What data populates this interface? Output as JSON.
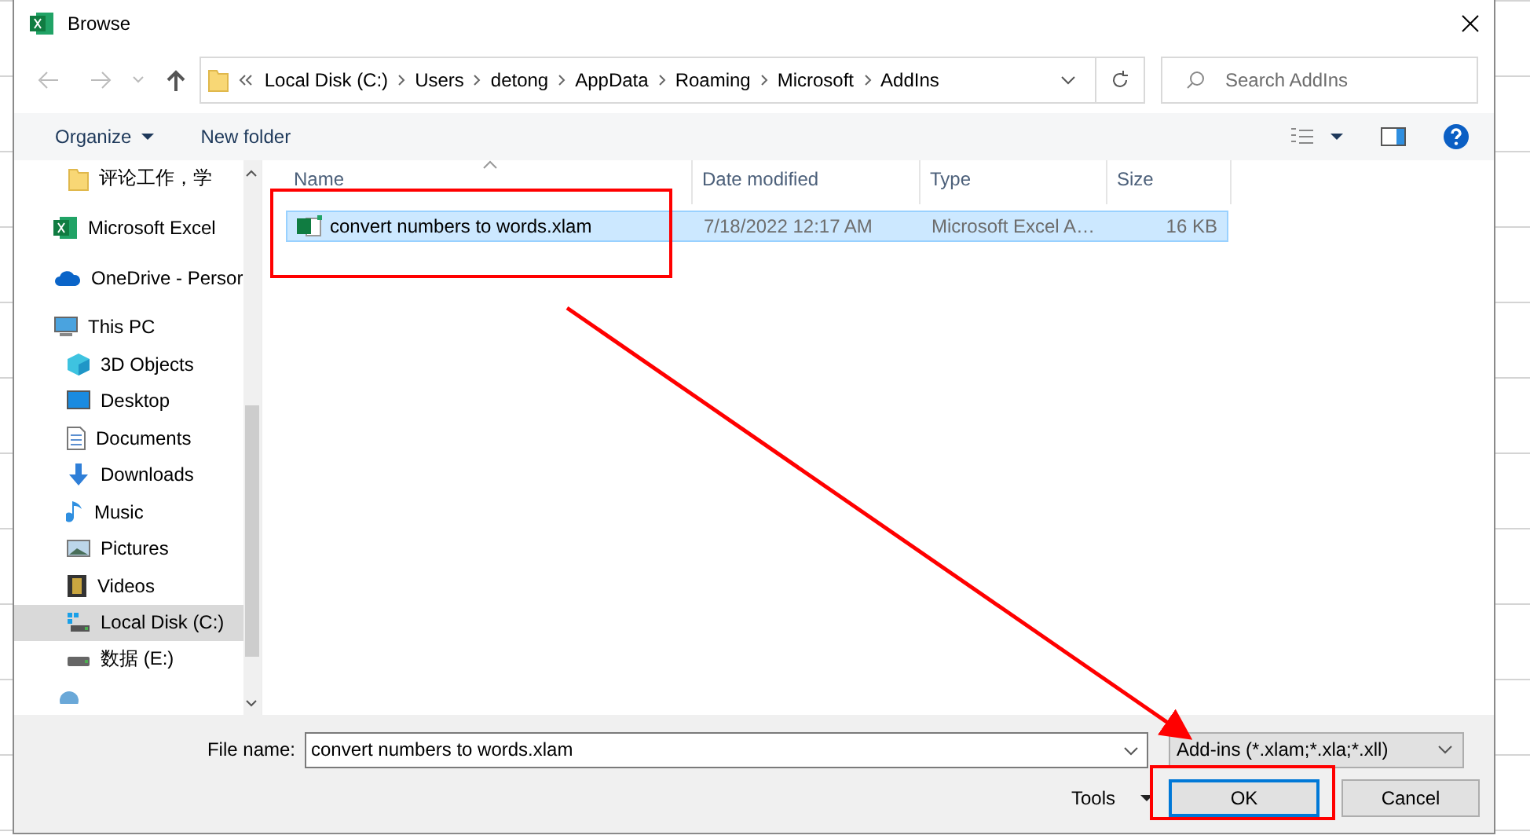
{
  "window": {
    "title": "Browse"
  },
  "address": {
    "path": [
      "Local Disk (C:)",
      "Users",
      "detong",
      "AppData",
      "Roaming",
      "Microsoft",
      "AddIns"
    ]
  },
  "search": {
    "placeholder": "Search AddIns"
  },
  "toolbar": {
    "organize": "Organize",
    "new_folder": "New folder"
  },
  "sidebar": {
    "pinned": [
      {
        "label": "评论工作，学",
        "kind": "folder",
        "selected": false
      }
    ],
    "items": [
      {
        "label": "Microsoft Excel",
        "kind": "excel",
        "selected": false
      },
      {
        "label": "OneDrive - Persor",
        "kind": "cloud",
        "selected": false
      },
      {
        "label": "This PC",
        "kind": "pc",
        "selected": false,
        "children": [
          {
            "label": "3D Objects",
            "kind": "cube",
            "selected": false
          },
          {
            "label": "Desktop",
            "kind": "desktop",
            "selected": false
          },
          {
            "label": "Documents",
            "kind": "document",
            "selected": false
          },
          {
            "label": "Downloads",
            "kind": "download",
            "selected": false
          },
          {
            "label": "Music",
            "kind": "music",
            "selected": false
          },
          {
            "label": "Pictures",
            "kind": "picture",
            "selected": false
          },
          {
            "label": "Videos",
            "kind": "video",
            "selected": false
          },
          {
            "label": "Local Disk (C:)",
            "kind": "disk",
            "selected": true
          },
          {
            "label": "数据 (E:)",
            "kind": "drive",
            "selected": false
          }
        ]
      }
    ]
  },
  "table": {
    "columns": [
      "Name",
      "Date modified",
      "Type",
      "Size"
    ],
    "rows": [
      {
        "name": "convert numbers to words.xlam",
        "date": "7/18/2022 12:17 AM",
        "type": "Microsoft Excel A…",
        "size": "16 KB",
        "selected": true
      }
    ]
  },
  "file_name": {
    "label": "File name:",
    "value": "convert numbers to words.xlam"
  },
  "filter": {
    "value": "Add-ins (*.xlam;*.xla;*.xll)"
  },
  "tools": "Tools",
  "buttons": [
    {
      "label": "OK",
      "default": true
    },
    {
      "label": "Cancel",
      "default": false
    }
  ]
}
